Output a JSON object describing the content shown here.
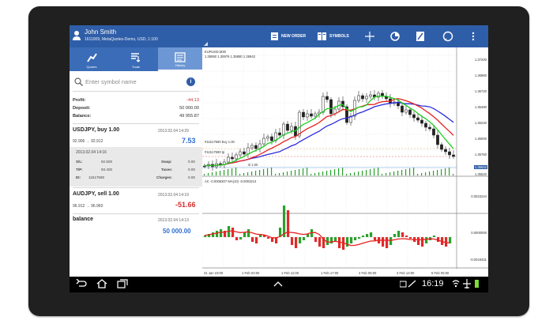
{
  "header": {
    "user_name": "John Smith",
    "account": "1611009, MetaQuotes-Demo, USD, 1:100",
    "new_order_label": "NEW ORDER",
    "symbols_label": "SYMBOLS",
    "color": "#2f5ea8"
  },
  "tabs": [
    {
      "label": "Quotes",
      "icon": "quotes-icon"
    },
    {
      "label": "Trade",
      "icon": "trade-icon"
    },
    {
      "label": "History",
      "icon": "history-icon",
      "active": true
    }
  ],
  "search": {
    "placeholder": "Enter symbol name"
  },
  "summary": {
    "profit_label": "Profit:",
    "profit_value": "-44.13",
    "deposit_label": "Deposit:",
    "deposit_value": "50 000.00",
    "balance_label": "Balance:",
    "balance_value": "49 955.87"
  },
  "deals": [
    {
      "title": "USDJPY, buy 1.00",
      "time": "2013.02.04 14:29",
      "prices": "92.906 → 92.912",
      "profit": "7.53"
    },
    {
      "title": "AUDJPY, sell 1.00",
      "time": "2013.02.04 14:19",
      "prices": "96.912 → 96.960",
      "profit": "-51.66"
    }
  ],
  "deal_detail": {
    "time": "2013.02.04 14:16",
    "sl_label": "S/L:",
    "sl_value": "92.500",
    "tp_label": "T/P:",
    "tp_value": "93.400",
    "id_label": "ID:",
    "id_value": "11517590",
    "swap_label": "Swap:",
    "swap_value": "0.00",
    "taxes_label": "Taxes:",
    "taxes_value": "0.00",
    "charges_label": "Charges:",
    "charges_value": "0.00"
  },
  "balance_entry": {
    "title": "balance",
    "time": "2013.02.04 14:13",
    "amount": "50 000.00"
  },
  "chart": {
    "symbol_line": "EURUSD,M30",
    "ohlc_line": "1.35950 1.35976 1.35880 1.35942",
    "price_ticks": [
      "1.37200",
      "1.36960",
      "1.36720",
      "1.36480",
      "1.36240",
      "1.36000",
      "1.35760",
      "1.35520"
    ],
    "current_price": "1.35642",
    "ac_label": "AC -0.0006307 MA(10) -0.0003214",
    "ac_ticks": [
      "0.0023244",
      "0.0000000",
      "-0.0019331"
    ],
    "time_ticks": [
      "31 Jan 23:00",
      "1 Feb 03:00",
      "1 Feb 11:00",
      "1 Feb 17:00",
      "4 Feb 05:00",
      "4 Feb 13:00",
      "6 Feb 05:00"
    ],
    "order_line_label": "#11517590 buy 1.00",
    "order_line_label2": "#11517590 tp",
    "order_line_label3": "sl 1.00",
    "up_color": "#2aa02a",
    "down_color": "#e02a2a",
    "ma_blue": "#2b2be0",
    "ma_red": "#e82020",
    "ma_green": "#22cc22"
  },
  "statusbar": {
    "time": "16:19"
  }
}
